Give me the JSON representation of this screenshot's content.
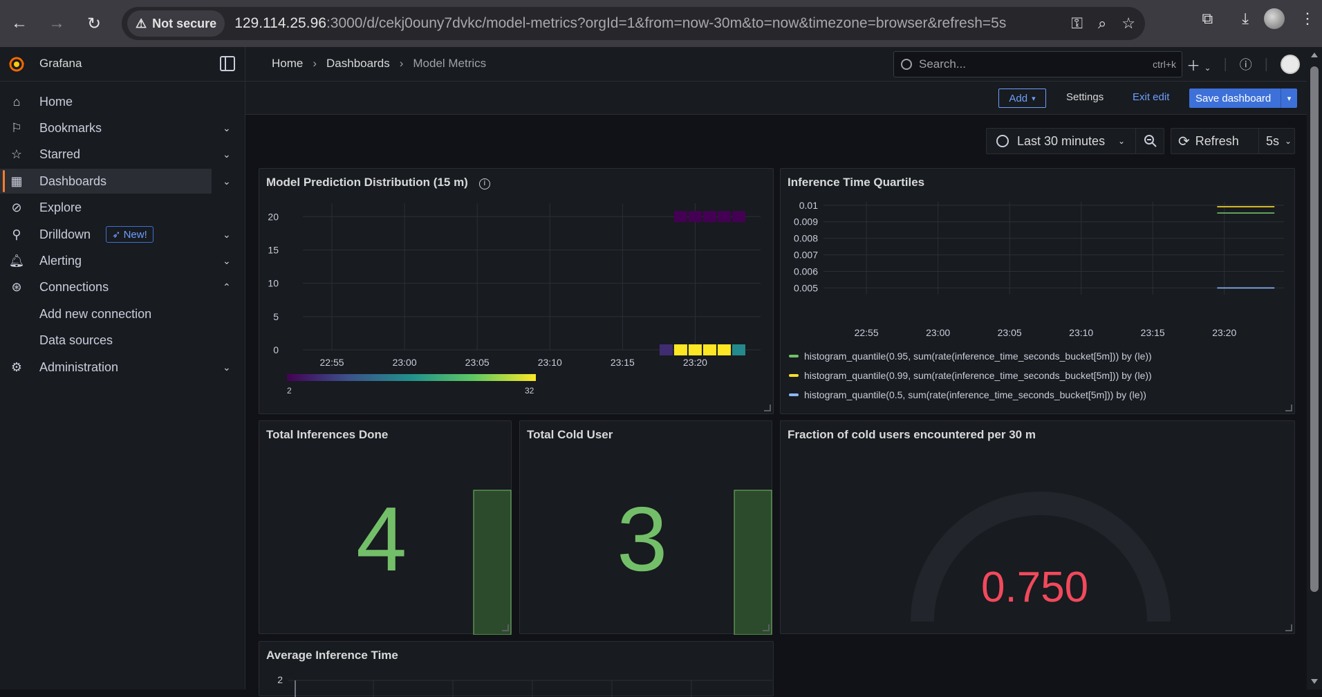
{
  "browser": {
    "security_label": "Not secure",
    "url_host": "129.114.25.96",
    "url_rest": ":3000/d/cekj0ouny7dvkc/model-metrics?orgId=1&from=now-30m&to=now&timezone=browser&refresh=5s"
  },
  "app": {
    "brand": "Grafana"
  },
  "breadcrumb": {
    "home": "Home",
    "dashboards": "Dashboards",
    "current": "Model Metrics"
  },
  "search": {
    "placeholder": "Search...",
    "shortcut": "ctrl+k"
  },
  "sidebar": {
    "items": [
      {
        "label": "Home",
        "icon": "home-icon"
      },
      {
        "label": "Bookmarks",
        "icon": "bookmark-icon"
      },
      {
        "label": "Starred",
        "icon": "star-icon"
      },
      {
        "label": "Dashboards",
        "icon": "dashboards-grid-icon"
      },
      {
        "label": "Explore",
        "icon": "compass-icon"
      },
      {
        "label": "Drilldown",
        "icon": "drilldown-icon",
        "badge": "New!"
      },
      {
        "label": "Alerting",
        "icon": "bell-icon"
      },
      {
        "label": "Connections",
        "icon": "connections-icon"
      },
      {
        "label": "Add new connection"
      },
      {
        "label": "Data sources"
      },
      {
        "label": "Administration",
        "icon": "gear-icon"
      }
    ]
  },
  "toolbar": {
    "add": "Add",
    "settings": "Settings",
    "exit_edit": "Exit edit",
    "save": "Save dashboard"
  },
  "time": {
    "range": "Last 30 minutes",
    "refresh": "Refresh",
    "interval": "5s"
  },
  "panels": {
    "heatmap": {
      "title": "Model Prediction Distribution (15 m)",
      "scale_min": "2",
      "scale_max": "32"
    },
    "quartiles": {
      "title": "Inference Time Quartiles"
    },
    "inferences": {
      "title": "Total Inferences Done",
      "value": "4"
    },
    "cold_user": {
      "title": "Total Cold User",
      "value": "3"
    },
    "fraction": {
      "title": "Fraction of cold users encountered per 30 m",
      "value": "0.750"
    },
    "avg_time": {
      "title": "Average Inference Time"
    }
  },
  "colors": {
    "accent": "#3d71d9",
    "stat_green": "#73bf69",
    "gauge_red": "#f2495c",
    "p95": "#73bf69",
    "p99": "#fade2a",
    "p50": "#8ab8ff"
  },
  "chart_data": [
    {
      "type": "heatmap",
      "title": "Model Prediction Distribution (15 m)",
      "x_ticks": [
        "22:55",
        "23:00",
        "23:05",
        "23:10",
        "23:15",
        "23:20"
      ],
      "y_ticks": [
        "0",
        "5",
        "10",
        "15",
        "20"
      ],
      "ylim": [
        0,
        22
      ],
      "color_scale": [
        2,
        32
      ],
      "cells": [
        {
          "time": "23:18:00",
          "y": 0,
          "value": 6
        },
        {
          "time": "23:19:00",
          "y": 0,
          "value": 32
        },
        {
          "time": "23:20:00",
          "y": 0,
          "value": 32
        },
        {
          "time": "23:21:00",
          "y": 0,
          "value": 32
        },
        {
          "time": "23:22:00",
          "y": 0,
          "value": 32
        },
        {
          "time": "23:23:00",
          "y": 0,
          "value": 16
        },
        {
          "time": "23:19:00",
          "y": 20,
          "value": 2
        },
        {
          "time": "23:20:00",
          "y": 20,
          "value": 2
        },
        {
          "time": "23:21:00",
          "y": 20,
          "value": 2
        },
        {
          "time": "23:22:00",
          "y": 20,
          "value": 2
        },
        {
          "time": "23:23:00",
          "y": 20,
          "value": 2
        }
      ]
    },
    {
      "type": "line",
      "title": "Inference Time Quartiles",
      "x_ticks": [
        "22:55",
        "23:00",
        "23:05",
        "23:10",
        "23:15",
        "23:20"
      ],
      "y_ticks": [
        "0.005",
        "0.006",
        "0.007",
        "0.008",
        "0.009",
        "0.01"
      ],
      "ylim": [
        0.0046,
        0.0102
      ],
      "legend_placement": "bottom",
      "series": [
        {
          "name": "histogram_quantile(0.95, sum(rate(inference_time_seconds_bucket[5m])) by (le))",
          "x": [
            "23:19:30",
            "23:23:30"
          ],
          "values": [
            0.00953,
            0.00953
          ],
          "color": "#73bf69"
        },
        {
          "name": "histogram_quantile(0.99, sum(rate(inference_time_seconds_bucket[5m])) by (le))",
          "x": [
            "23:19:30",
            "23:23:30"
          ],
          "values": [
            0.00991,
            0.00991
          ],
          "color": "#fade2a"
        },
        {
          "name": "histogram_quantile(0.5, sum(rate(inference_time_seconds_bucket[5m])) by (le))",
          "x": [
            "23:19:30",
            "23:23:30"
          ],
          "values": [
            0.005,
            0.005
          ],
          "color": "#8ab8ff"
        }
      ]
    },
    {
      "type": "line",
      "title": "Average Inference Time",
      "y_ticks": [
        "2"
      ]
    }
  ]
}
